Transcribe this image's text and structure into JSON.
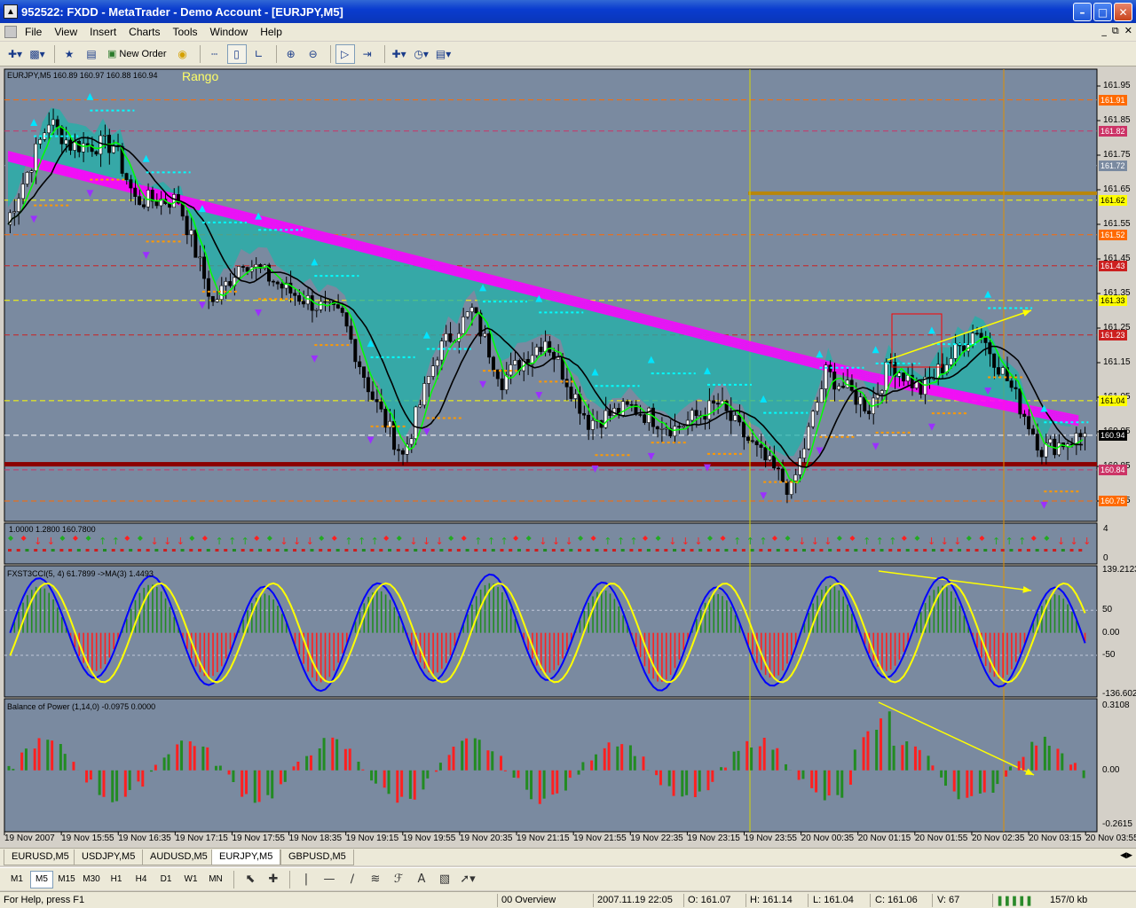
{
  "window": {
    "title": "952522: FXDD - MetaTrader - Demo Account - [EURJPY,M5]",
    "minimize": "0",
    "maximize": "1",
    "close": "r"
  },
  "menu": {
    "items": [
      "File",
      "View",
      "Insert",
      "Charts",
      "Tools",
      "Window",
      "Help"
    ]
  },
  "toolbar": {
    "new_order": "New Order"
  },
  "chart": {
    "header": "EURJPY,M5  160.89 160.97 160.88 160.94",
    "rango": "Rango",
    "price_ticks": [
      "161.95",
      "161.85",
      "161.75",
      "161.65",
      "161.55",
      "161.45",
      "161.35",
      "161.25",
      "161.15",
      "161.05",
      "160.95",
      "160.85",
      "160.75"
    ],
    "tag_labels": [
      {
        "text": "161.91",
        "color": "#ff6a00"
      },
      {
        "text": "161.82",
        "color": "#cc3366"
      },
      {
        "text": "161.72",
        "color": "#7a8aa0"
      },
      {
        "text": "161.62",
        "color": "#ffff00"
      },
      {
        "text": "161.52",
        "color": "#ff6a00"
      },
      {
        "text": "161.43",
        "color": "#cc2020"
      },
      {
        "text": "161.33",
        "color": "#ffff00"
      },
      {
        "text": "161.23",
        "color": "#cc2020"
      },
      {
        "text": "161.04",
        "color": "#ffff00"
      },
      {
        "text": "160.94",
        "color": "#000000"
      },
      {
        "text": "160.84",
        "color": "#cc3366"
      },
      {
        "text": "160.75",
        "color": "#ff6a00"
      }
    ],
    "signal_panel": {
      "header": "1.0000    1.2800  160.7800",
      "scale_top": "4",
      "scale_bottom": "0"
    },
    "cci_panel": {
      "header": "FXST3CCI(5, 4) 61.7899  ->MA(3) 1.4493",
      "ticks": [
        "139.2123",
        "50",
        "0.00",
        "-50",
        "-136.602"
      ]
    },
    "bop_panel": {
      "header": "Balance of Power (1,14,0) -0.0975 0.0000",
      "ticks": [
        "0.3108",
        "0.00",
        "-0.2615"
      ]
    },
    "time_labels": [
      "19 Nov 2007",
      "19 Nov 15:55",
      "19 Nov 16:35",
      "19 Nov 17:15",
      "19 Nov 17:55",
      "19 Nov 18:35",
      "19 Nov 19:15",
      "19 Nov 19:55",
      "19 Nov 20:35",
      "19 Nov 21:15",
      "19 Nov 21:55",
      "19 Nov 22:35",
      "19 Nov 23:15",
      "19 Nov 23:55",
      "20 Nov 00:35",
      "20 Nov 01:15",
      "20 Nov 01:55",
      "20 Nov 02:35",
      "20 Nov 03:15",
      "20 Nov 03:55"
    ]
  },
  "chart_tabs": [
    "EURUSD,M5",
    "USDJPY,M5",
    "AUDUSD,M5",
    "EURJPY,M5",
    "GBPUSD,M5"
  ],
  "active_tab": "EURJPY,M5",
  "timeframes": [
    "M1",
    "M5",
    "M15",
    "M30",
    "H1",
    "H4",
    "D1",
    "W1",
    "MN"
  ],
  "active_timeframe": "M5",
  "status": {
    "help": "For Help, press F1",
    "profile": "00 Overview",
    "datetime": "2007.11.19 22:05",
    "open": "O: 161.07",
    "high": "H: 161.14",
    "low": "L: 161.04",
    "close": "C: 161.06",
    "volume": "V: 67",
    "traffic": "157/0 kb"
  },
  "colors": {
    "chart_bg": "#7a8aa0",
    "ema_band": "#ff00ff",
    "cloud": "#20b2aa",
    "bull_bar": "#228b22",
    "bear_bar": "#ff2020",
    "cci_main": "#0000ff",
    "cci_signal": "#ffff00",
    "support_line": "#8b0000"
  }
}
